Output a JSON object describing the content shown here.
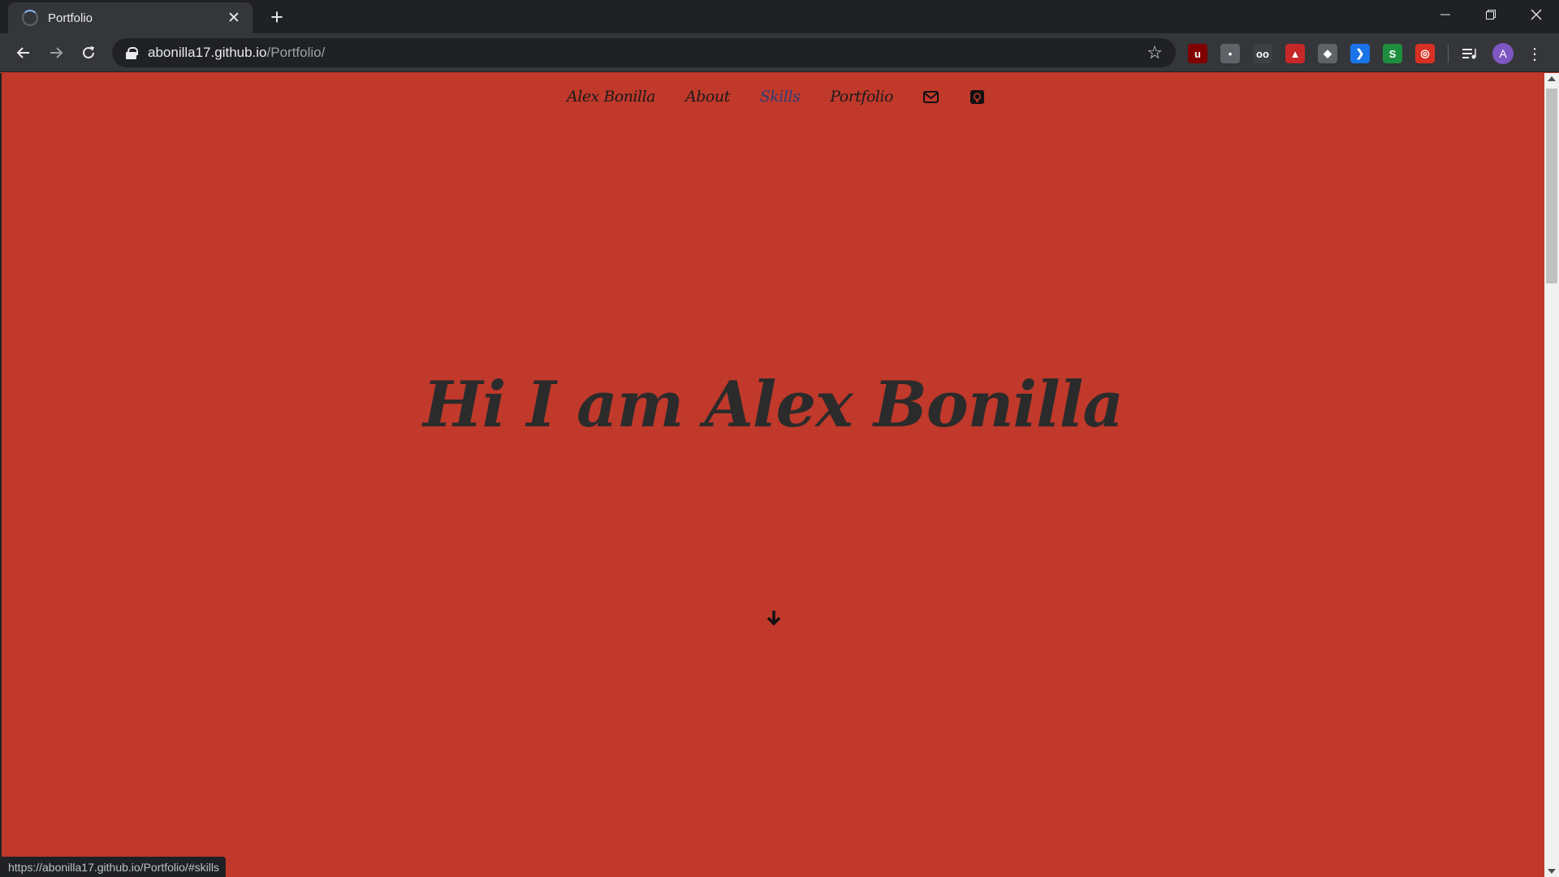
{
  "browser": {
    "tab_title": "Portfolio",
    "tab_close_glyph": "✕",
    "new_tab_glyph": "+",
    "url_host": "abonilla17.github.io",
    "url_path": "/Portfolio/",
    "avatar_letter": "A",
    "status_url": "https://abonilla17.github.io/Portfolio/#skills",
    "extensions": [
      {
        "name": "ublock-origin-icon",
        "color": "#800000",
        "glyph": "u"
      },
      {
        "name": "puzzle-extension-icon",
        "color": "#5f6368",
        "glyph": "•"
      },
      {
        "name": "reader-glasses-icon",
        "color": "#3c4043",
        "glyph": "oo"
      },
      {
        "name": "pdf-extension-icon",
        "color": "#c62828",
        "glyph": "▲"
      },
      {
        "name": "ghost-extension-icon",
        "color": "#5f6368",
        "glyph": "◆"
      },
      {
        "name": "arrow-extension-icon",
        "color": "#1a73e8",
        "glyph": "❯"
      },
      {
        "name": "s-extension-icon",
        "color": "#1e8e3e",
        "glyph": "S"
      },
      {
        "name": "swirl-extension-icon",
        "color": "#d93025",
        "glyph": "◎"
      }
    ]
  },
  "site": {
    "nav": {
      "brand": "Alex Bonilla",
      "about": "About",
      "skills": "Skills",
      "portfolio": "Portfolio"
    },
    "hero_title": "Hi I am Alex Bonilla",
    "colors": {
      "background": "#c0392b",
      "active_link": "#2c3e78",
      "text": "#2b2b2b"
    }
  }
}
